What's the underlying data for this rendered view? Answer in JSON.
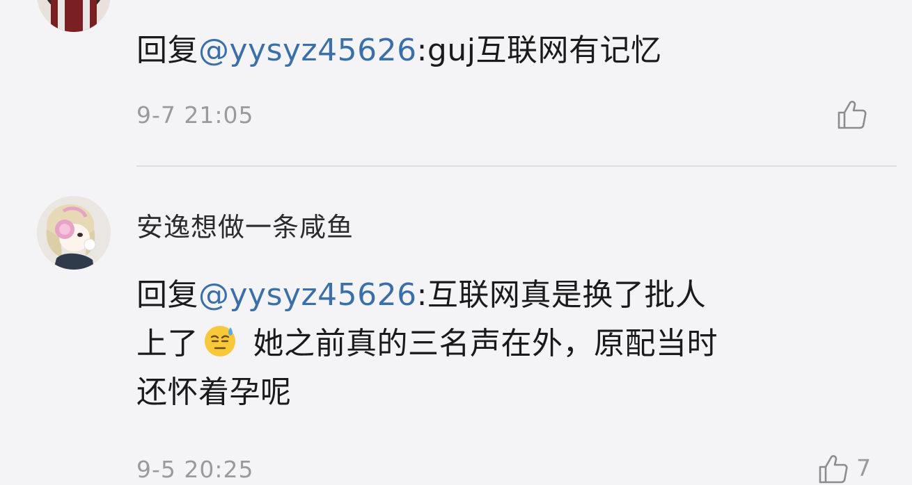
{
  "comments": [
    {
      "reply_prefix": "回复",
      "mention": "@yysyz45626",
      "reply_body": ":guj互联网有记忆",
      "timestamp": "9-7 21:05",
      "like_icon": "thumbs-up-icon"
    },
    {
      "username": "安逸想做一条咸鱼",
      "reply_prefix": "回复",
      "mention": "@yysyz45626",
      "reply_line1_rest": ":互联网真是换了批人",
      "reply_line2_start": "上了",
      "emoji": "sweat-smile-emoji-icon",
      "reply_line2_rest": " 她之前真的三名声在外，原配当时",
      "reply_line3": "还怀着孕呢",
      "timestamp": "9-5 20:25",
      "like_count": "7",
      "like_icon": "thumbs-up-icon"
    }
  ],
  "colors": {
    "background": "#f4f4f7",
    "mention": "#3a6fa8",
    "timestamp": "#9a9a9a",
    "divider": "#dedee2"
  }
}
